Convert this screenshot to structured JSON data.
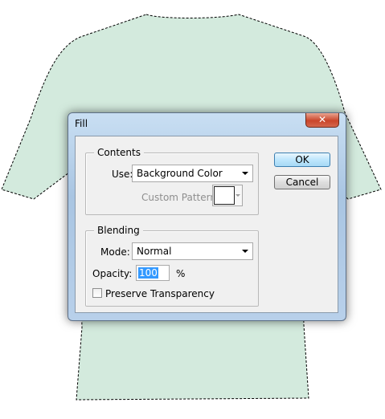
{
  "dialog": {
    "title": "Fill",
    "close_glyph": "✕",
    "contents": {
      "legend": "Contents",
      "use_label": "Use:",
      "use_value": "Background Color",
      "custom_pattern_label": "Custom Pattern:"
    },
    "blending": {
      "legend": "Blending",
      "mode_label": "Mode:",
      "mode_value": "Normal",
      "opacity_label": "Opacity:",
      "opacity_value": "100",
      "opacity_unit": "%",
      "preserve_label": "Preserve Transparency"
    },
    "buttons": {
      "ok": "OK",
      "cancel": "Cancel"
    }
  },
  "colors": {
    "shirt_fill": "#d3eadd",
    "selection_border": "#000000",
    "accent": "#3399ff"
  }
}
